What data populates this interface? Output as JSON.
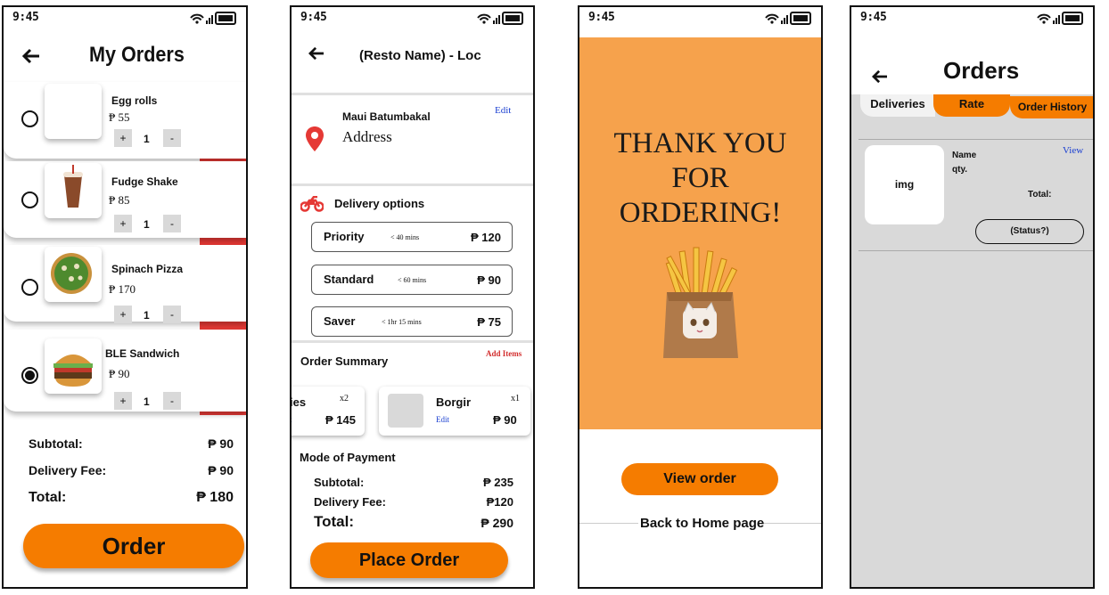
{
  "status_time": "9:45",
  "screen1": {
    "title": "My Orders",
    "items": [
      {
        "name": "Egg rolls",
        "price": "₱ 55",
        "qty": "1",
        "selected": false
      },
      {
        "name": "Fudge Shake",
        "price": "₱ 85",
        "qty": "1",
        "selected": false
      },
      {
        "name": "Spinach Pizza",
        "price": "₱ 170",
        "qty": "1",
        "selected": false
      },
      {
        "name": "BLE Sandwich",
        "price": "₱ 90",
        "qty": "1",
        "selected": true
      }
    ],
    "plus": "+",
    "minus": "-",
    "subtotal_label": "Subtotal:",
    "subtotal_value": "₱ 90",
    "delivery_label": "Delivery Fee:",
    "delivery_value": "₱ 90",
    "total_label": "Total:",
    "total_value": "₱ 180",
    "order_button": "Order"
  },
  "screen2": {
    "title": "(Resto Name) - Loc",
    "customer_name": "Maui Batumbakal",
    "address": "Address",
    "edit": "Edit",
    "delivery_options_label": "Delivery options",
    "options": [
      {
        "name": "Priority",
        "time": "< 40 mins",
        "price": "₱ 120"
      },
      {
        "name": "Standard",
        "time": "< 60 mins",
        "price": "₱ 90"
      },
      {
        "name": "Saver",
        "time": "< 1hr 15 mins",
        "price": "₱ 75"
      }
    ],
    "order_summary_label": "Order Summary",
    "add_items": "Add Items",
    "summary_items": [
      {
        "name": "ies",
        "qty": "x2",
        "price": "₱ 145",
        "edit": "t"
      },
      {
        "name": "Borgir",
        "qty": "x1",
        "price": "₱ 90",
        "edit": "Edit"
      }
    ],
    "payment_label": "Mode of Payment",
    "subtotal_label": "Subtotal:",
    "subtotal_value": "₱ 235",
    "delivery_label": "Delivery Fee:",
    "delivery_value": "₱120",
    "total_label": "Total:",
    "total_value": "₱ 290",
    "place_order_button": "Place Order"
  },
  "screen3": {
    "line1": "THANK YOU",
    "line2": "FOR",
    "line3": "ORDERING!",
    "view_order_button": "View order",
    "back_home": "Back to Home page"
  },
  "screen4": {
    "title": "Orders",
    "tabs": [
      "Deliveries",
      "Rate",
      "Order History"
    ],
    "img_label": "img",
    "name_label": "Name",
    "qty_label": "qty.",
    "total_label": "Total:",
    "view_link": "View",
    "status_button": "(Status?)"
  },
  "colors": {
    "accent": "#f57c00",
    "danger": "#e53935",
    "thank_you_bg": "#f6a24c",
    "link": "#1a3fd1",
    "gray_bg": "#d9d9d9"
  }
}
